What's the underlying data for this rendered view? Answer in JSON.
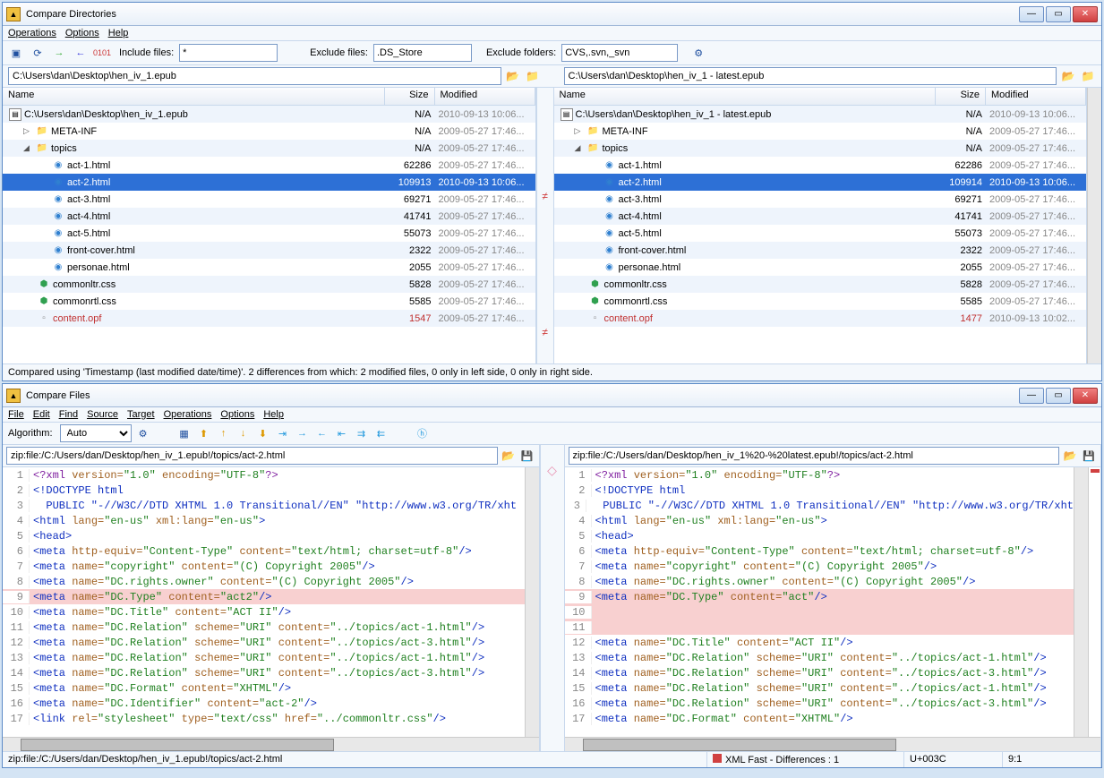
{
  "win1": {
    "title": "Compare Directories",
    "menu": [
      "Operations",
      "Options",
      "Help"
    ],
    "filters": {
      "include_label": "Include files:",
      "include_val": "*",
      "exclude_files_label": "Exclude files:",
      "exclude_files_val": ".DS_Store",
      "exclude_folders_label": "Exclude folders:",
      "exclude_folders_val": "CVS,.svn,_svn"
    },
    "left_path": "C:\\Users\\dan\\Desktop\\hen_iv_1.epub",
    "right_path": "C:\\Users\\dan\\Desktop\\hen_iv_1 - latest.epub",
    "cols": {
      "name": "Name",
      "size": "Size",
      "mod": "Modified"
    },
    "left_rows": [
      {
        "icon": "zip",
        "name": "C:\\Users\\dan\\Desktop\\hen_iv_1.epub",
        "size": "N/A",
        "mod": "2010-09-13  10:06...",
        "indent": 0
      },
      {
        "icon": "fld",
        "name": "META-INF",
        "size": "N/A",
        "mod": "2009-05-27  17:46...",
        "indent": 1,
        "exp": "▷"
      },
      {
        "icon": "fld",
        "name": "topics",
        "size": "N/A",
        "mod": "2009-05-27  17:46...",
        "indent": 1,
        "exp": "◢"
      },
      {
        "icon": "html",
        "name": "act-1.html",
        "size": "62286",
        "mod": "2009-05-27  17:46...",
        "indent": 3
      },
      {
        "icon": "html",
        "name": "act-2.html",
        "size": "109913",
        "mod": "2010-09-13  10:06...",
        "indent": 3,
        "sel": true
      },
      {
        "icon": "html",
        "name": "act-3.html",
        "size": "69271",
        "mod": "2009-05-27  17:46...",
        "indent": 3
      },
      {
        "icon": "html",
        "name": "act-4.html",
        "size": "41741",
        "mod": "2009-05-27  17:46...",
        "indent": 3
      },
      {
        "icon": "html",
        "name": "act-5.html",
        "size": "55073",
        "mod": "2009-05-27  17:46...",
        "indent": 3
      },
      {
        "icon": "html",
        "name": "front-cover.html",
        "size": "2322",
        "mod": "2009-05-27  17:46...",
        "indent": 3
      },
      {
        "icon": "html",
        "name": "personae.html",
        "size": "2055",
        "mod": "2009-05-27  17:46...",
        "indent": 3
      },
      {
        "icon": "css",
        "name": "commonltr.css",
        "size": "5828",
        "mod": "2009-05-27  17:46...",
        "indent": 2
      },
      {
        "icon": "css",
        "name": "commonrtl.css",
        "size": "5585",
        "mod": "2009-05-27  17:46...",
        "indent": 2
      },
      {
        "icon": "file",
        "name": "content.opf",
        "size": "1547",
        "mod": "2009-05-27  17:46...",
        "indent": 2,
        "red": true
      }
    ],
    "right_rows": [
      {
        "icon": "zip",
        "name": "C:\\Users\\dan\\Desktop\\hen_iv_1 - latest.epub",
        "size": "N/A",
        "mod": "2010-09-13  10:06...",
        "indent": 0
      },
      {
        "icon": "fld",
        "name": "META-INF",
        "size": "N/A",
        "mod": "2009-05-27  17:46...",
        "indent": 1,
        "exp": "▷"
      },
      {
        "icon": "fld",
        "name": "topics",
        "size": "N/A",
        "mod": "2009-05-27  17:46...",
        "indent": 1,
        "exp": "◢"
      },
      {
        "icon": "html",
        "name": "act-1.html",
        "size": "62286",
        "mod": "2009-05-27  17:46...",
        "indent": 3
      },
      {
        "icon": "html",
        "name": "act-2.html",
        "size": "109914",
        "mod": "2010-09-13  10:06...",
        "indent": 3,
        "sel": true
      },
      {
        "icon": "html",
        "name": "act-3.html",
        "size": "69271",
        "mod": "2009-05-27  17:46...",
        "indent": 3
      },
      {
        "icon": "html",
        "name": "act-4.html",
        "size": "41741",
        "mod": "2009-05-27  17:46...",
        "indent": 3
      },
      {
        "icon": "html",
        "name": "act-5.html",
        "size": "55073",
        "mod": "2009-05-27  17:46...",
        "indent": 3
      },
      {
        "icon": "html",
        "name": "front-cover.html",
        "size": "2322",
        "mod": "2009-05-27  17:46...",
        "indent": 3
      },
      {
        "icon": "html",
        "name": "personae.html",
        "size": "2055",
        "mod": "2009-05-27  17:46...",
        "indent": 3
      },
      {
        "icon": "css",
        "name": "commonltr.css",
        "size": "5828",
        "mod": "2009-05-27  17:46...",
        "indent": 2
      },
      {
        "icon": "css",
        "name": "commonrtl.css",
        "size": "5585",
        "mod": "2009-05-27  17:46...",
        "indent": 2
      },
      {
        "icon": "file",
        "name": "content.opf",
        "size": "1477",
        "mod": "2010-09-13  10:02...",
        "indent": 2,
        "red": true
      }
    ],
    "gutter_marks": [
      4,
      12
    ],
    "status": "Compared using 'Timestamp (last modified date/time)'. 2 differences from which: 2 modified files, 0 only in left side, 0 only in right side."
  },
  "win2": {
    "title": "Compare Files",
    "menu": [
      "File",
      "Edit",
      "Find",
      "Source",
      "Target",
      "Operations",
      "Options",
      "Help"
    ],
    "algo_label": "Algorithm:",
    "algo_val": "Auto",
    "left_path": "zip:file:/C:/Users/dan/Desktop/hen_iv_1.epub!/topics/act-2.html",
    "right_path": "zip:file:/C:/Users/dan/Desktop/hen_iv_1%20-%20latest.epub!/topics/act-2.html",
    "left_code": [
      {
        "n": 1,
        "h": "<span class='t-purple'>&lt;?xml</span> <span class='t-brown'>version=</span><span class='t-green'>\"1.0\"</span> <span class='t-brown'>encoding=</span><span class='t-green'>\"UTF-8\"</span><span class='t-purple'>?&gt;</span>"
      },
      {
        "n": 2,
        "h": "<span class='t-blue'>&lt;!DOCTYPE html</span>"
      },
      {
        "n": 3,
        "h": "<span class='t-blue'>  PUBLIC \"-//W3C//DTD XHTML 1.0 Transitional//EN\" \"http://www.w3.org/TR/xht</span>"
      },
      {
        "n": 4,
        "h": "<span class='t-blue'>&lt;html</span> <span class='t-brown'>lang=</span><span class='t-green'>\"en-us\"</span> <span class='t-brown'>xml:lang=</span><span class='t-green'>\"en-us\"</span><span class='t-blue'>&gt;</span>"
      },
      {
        "n": 5,
        "h": "<span class='t-blue'>&lt;head&gt;</span>"
      },
      {
        "n": 6,
        "h": "<span class='t-blue'>&lt;meta</span> <span class='t-brown'>http-equiv=</span><span class='t-green'>\"Content-Type\"</span> <span class='t-brown'>content=</span><span class='t-green'>\"text/html; charset=utf-8\"</span><span class='t-blue'>/&gt;</span>"
      },
      {
        "n": 7,
        "h": "<span class='t-blue'>&lt;meta</span> <span class='t-brown'>name=</span><span class='t-green'>\"copyright\"</span> <span class='t-brown'>content=</span><span class='t-green'>\"(C) Copyright 2005\"</span><span class='t-blue'>/&gt;</span>"
      },
      {
        "n": 8,
        "h": "<span class='t-blue'>&lt;meta</span> <span class='t-brown'>name=</span><span class='t-green'>\"DC.rights.owner\"</span> <span class='t-brown'>content=</span><span class='t-green'>\"(C) Copyright 2005\"</span><span class='t-blue'>/&gt;</span>"
      },
      {
        "n": 9,
        "h": "<span class='t-blue'>&lt;meta</span> <span class='t-brown'>name=</span><span class='t-green'>\"DC.Type\"</span> <span class='t-brown'>content=</span><span class='t-green'>\"act2\"</span><span class='t-blue'>/&gt;</span>",
        "diff": true
      },
      {
        "n": 10,
        "h": "<span class='t-blue'>&lt;meta</span> <span class='t-brown'>name=</span><span class='t-green'>\"DC.Title\"</span> <span class='t-brown'>content=</span><span class='t-green'>\"ACT II\"</span><span class='t-blue'>/&gt;</span>"
      },
      {
        "n": 11,
        "h": "<span class='t-blue'>&lt;meta</span> <span class='t-brown'>name=</span><span class='t-green'>\"DC.Relation\"</span> <span class='t-brown'>scheme=</span><span class='t-green'>\"URI\"</span> <span class='t-brown'>content=</span><span class='t-green'>\"../topics/act-1.html\"</span><span class='t-blue'>/&gt;</span>"
      },
      {
        "n": 12,
        "h": "<span class='t-blue'>&lt;meta</span> <span class='t-brown'>name=</span><span class='t-green'>\"DC.Relation\"</span> <span class='t-brown'>scheme=</span><span class='t-green'>\"URI\"</span> <span class='t-brown'>content=</span><span class='t-green'>\"../topics/act-3.html\"</span><span class='t-blue'>/&gt;</span>"
      },
      {
        "n": 13,
        "h": "<span class='t-blue'>&lt;meta</span> <span class='t-brown'>name=</span><span class='t-green'>\"DC.Relation\"</span> <span class='t-brown'>scheme=</span><span class='t-green'>\"URI\"</span> <span class='t-brown'>content=</span><span class='t-green'>\"../topics/act-1.html\"</span><span class='t-blue'>/&gt;</span>"
      },
      {
        "n": 14,
        "h": "<span class='t-blue'>&lt;meta</span> <span class='t-brown'>name=</span><span class='t-green'>\"DC.Relation\"</span> <span class='t-brown'>scheme=</span><span class='t-green'>\"URI\"</span> <span class='t-brown'>content=</span><span class='t-green'>\"../topics/act-3.html\"</span><span class='t-blue'>/&gt;</span>"
      },
      {
        "n": 15,
        "h": "<span class='t-blue'>&lt;meta</span> <span class='t-brown'>name=</span><span class='t-green'>\"DC.Format\"</span> <span class='t-brown'>content=</span><span class='t-green'>\"XHTML\"</span><span class='t-blue'>/&gt;</span>"
      },
      {
        "n": 16,
        "h": "<span class='t-blue'>&lt;meta</span> <span class='t-brown'>name=</span><span class='t-green'>\"DC.Identifier\"</span> <span class='t-brown'>content=</span><span class='t-green'>\"act-2\"</span><span class='t-blue'>/&gt;</span>"
      },
      {
        "n": 17,
        "h": "<span class='t-blue'>&lt;link</span> <span class='t-brown'>rel=</span><span class='t-green'>\"stylesheet\"</span> <span class='t-brown'>type=</span><span class='t-green'>\"text/css\"</span> <span class='t-brown'>href=</span><span class='t-green'>\"../commonltr.css\"</span><span class='t-blue'>/&gt;</span>"
      }
    ],
    "right_code": [
      {
        "n": 1,
        "h": "<span class='t-purple'>&lt;?xml</span> <span class='t-brown'>version=</span><span class='t-green'>\"1.0\"</span> <span class='t-brown'>encoding=</span><span class='t-green'>\"UTF-8\"</span><span class='t-purple'>?&gt;</span>"
      },
      {
        "n": 2,
        "h": "<span class='t-blue'>&lt;!DOCTYPE html</span>"
      },
      {
        "n": 3,
        "h": "<span class='t-blue'>  PUBLIC \"-//W3C//DTD XHTML 1.0 Transitional//EN\" \"http://www.w3.org/TR/xht</span>"
      },
      {
        "n": 4,
        "h": "<span class='t-blue'>&lt;html</span> <span class='t-brown'>lang=</span><span class='t-green'>\"en-us\"</span> <span class='t-brown'>xml:lang=</span><span class='t-green'>\"en-us\"</span><span class='t-blue'>&gt;</span>"
      },
      {
        "n": 5,
        "h": "<span class='t-blue'>&lt;head&gt;</span>"
      },
      {
        "n": 6,
        "h": "<span class='t-blue'>&lt;meta</span> <span class='t-brown'>http-equiv=</span><span class='t-green'>\"Content-Type\"</span> <span class='t-brown'>content=</span><span class='t-green'>\"text/html; charset=utf-8\"</span><span class='t-blue'>/&gt;</span>"
      },
      {
        "n": 7,
        "h": "<span class='t-blue'>&lt;meta</span> <span class='t-brown'>name=</span><span class='t-green'>\"copyright\"</span> <span class='t-brown'>content=</span><span class='t-green'>\"(C) Copyright 2005\"</span><span class='t-blue'>/&gt;</span>"
      },
      {
        "n": 8,
        "h": "<span class='t-blue'>&lt;meta</span> <span class='t-brown'>name=</span><span class='t-green'>\"DC.rights.owner\"</span> <span class='t-brown'>content=</span><span class='t-green'>\"(C) Copyright 2005\"</span><span class='t-blue'>/&gt;</span>"
      },
      {
        "n": 9,
        "h": "<span class='t-blue'>&lt;meta</span> <span class='t-brown'>name=</span><span class='t-green'>\"DC.Type\"</span> <span class='t-brown'>content=</span><span class='t-green'>\"act\"</span><span class='t-blue'>/&gt;</span>",
        "diff": true
      },
      {
        "n": 10,
        "h": "",
        "diff": true
      },
      {
        "n": 11,
        "h": "",
        "diff": true
      },
      {
        "n": 12,
        "h": "<span class='t-blue'>&lt;meta</span> <span class='t-brown'>name=</span><span class='t-green'>\"DC.Title\"</span> <span class='t-brown'>content=</span><span class='t-green'>\"ACT II\"</span><span class='t-blue'>/&gt;</span>"
      },
      {
        "n": 13,
        "h": "<span class='t-blue'>&lt;meta</span> <span class='t-brown'>name=</span><span class='t-green'>\"DC.Relation\"</span> <span class='t-brown'>scheme=</span><span class='t-green'>\"URI\"</span> <span class='t-brown'>content=</span><span class='t-green'>\"../topics/act-1.html\"</span><span class='t-blue'>/&gt;</span>"
      },
      {
        "n": 14,
        "h": "<span class='t-blue'>&lt;meta</span> <span class='t-brown'>name=</span><span class='t-green'>\"DC.Relation\"</span> <span class='t-brown'>scheme=</span><span class='t-green'>\"URI\"</span> <span class='t-brown'>content=</span><span class='t-green'>\"../topics/act-3.html\"</span><span class='t-blue'>/&gt;</span>"
      },
      {
        "n": 15,
        "h": "<span class='t-blue'>&lt;meta</span> <span class='t-brown'>name=</span><span class='t-green'>\"DC.Relation\"</span> <span class='t-brown'>scheme=</span><span class='t-green'>\"URI\"</span> <span class='t-brown'>content=</span><span class='t-green'>\"../topics/act-1.html\"</span><span class='t-blue'>/&gt;</span>"
      },
      {
        "n": 16,
        "h": "<span class='t-blue'>&lt;meta</span> <span class='t-brown'>name=</span><span class='t-green'>\"DC.Relation\"</span> <span class='t-brown'>scheme=</span><span class='t-green'>\"URI\"</span> <span class='t-brown'>content=</span><span class='t-green'>\"../topics/act-3.html\"</span><span class='t-blue'>/&gt;</span>"
      },
      {
        "n": 17,
        "h": "<span class='t-blue'>&lt;meta</span> <span class='t-brown'>name=</span><span class='t-green'>\"DC.Format\"</span> <span class='t-brown'>content=</span><span class='t-green'>\"XHTML\"</span><span class='t-blue'>/&gt;</span>"
      }
    ],
    "status_path": "zip:file:/C:/Users/dan/Desktop/hen_iv_1.epub!/topics/act-2.html",
    "status_diff": "XML Fast - Differences : 1",
    "status_char": "U+003C",
    "status_pos": "9:1"
  }
}
